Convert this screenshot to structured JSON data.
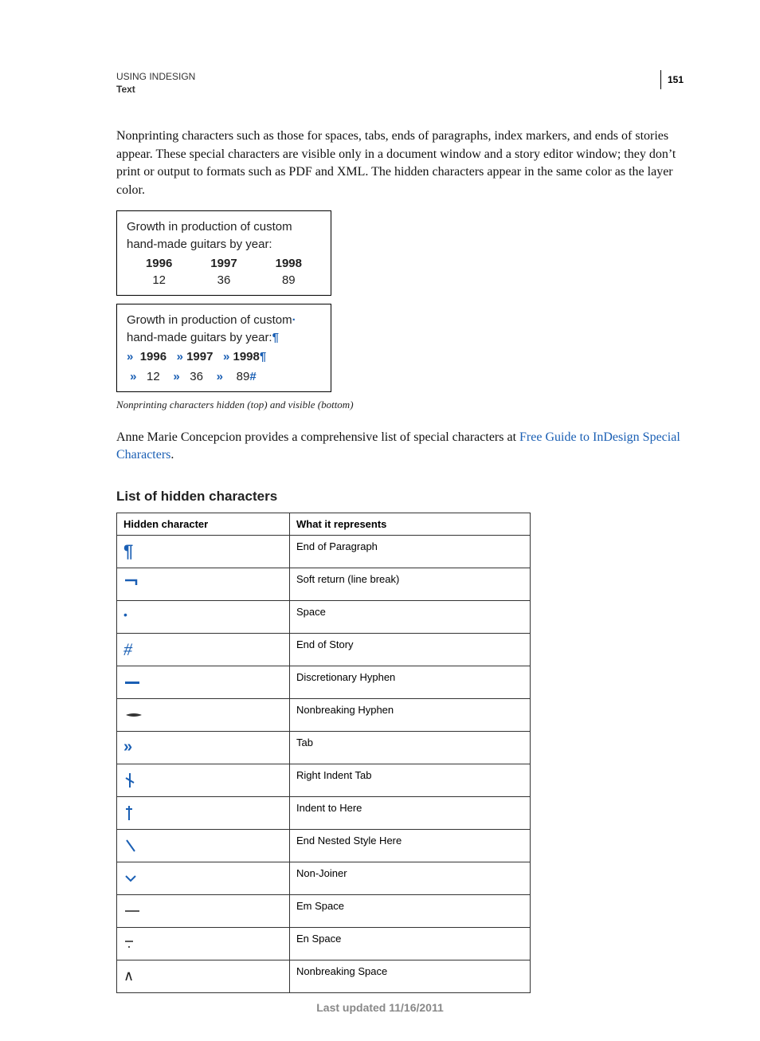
{
  "header": {
    "line1": "USING INDESIGN",
    "line2": "Text",
    "page_number": "151"
  },
  "paragraphs": {
    "intro": "Nonprinting characters such as those for spaces, tabs, ends of paragraphs, index markers, and ends of stories appear. These special characters are visible only in a document window and a story editor window; they don’t print or output to formats such as PDF and XML. The hidden characters appear in the same color as the layer color.",
    "link_lead": "Anne Marie Concepcion provides a comprehensive list of special characters at ",
    "link_text": "Free Guide to InDesign Special Characters",
    "link_trail": "."
  },
  "figure": {
    "title_line1": "Growth in production of custom",
    "title_line2": "hand-made guitars by year:",
    "years": [
      "1996",
      "1997",
      "1998"
    ],
    "values": [
      "12",
      "36",
      "89"
    ],
    "caption": "Nonprinting characters hidden (top) and visible (bottom)"
  },
  "section_heading": "List of hidden characters",
  "table": {
    "col1": "Hidden character",
    "col2": "What it represents",
    "rows": [
      {
        "symbol": "pilcrow",
        "meaning": "End of Paragraph"
      },
      {
        "symbol": "softreturn",
        "meaning": "Soft return (line break)"
      },
      {
        "symbol": "space-dot",
        "meaning": "Space"
      },
      {
        "symbol": "end-of-story",
        "meaning": "End of Story"
      },
      {
        "symbol": "disc-hyphen",
        "meaning": "Discretionary Hyphen"
      },
      {
        "symbol": "nb-hyphen",
        "meaning": "Nonbreaking Hyphen"
      },
      {
        "symbol": "tab",
        "meaning": "Tab"
      },
      {
        "symbol": "right-indent-tab",
        "meaning": "Right Indent Tab"
      },
      {
        "symbol": "indent-to-here",
        "meaning": "Indent to Here"
      },
      {
        "symbol": "end-nested",
        "meaning": "End Nested Style Here"
      },
      {
        "symbol": "non-joiner",
        "meaning": "Non-Joiner"
      },
      {
        "symbol": "em-space",
        "meaning": "Em Space"
      },
      {
        "symbol": "en-space",
        "meaning": "En Space"
      },
      {
        "symbol": "nb-space",
        "meaning": "Nonbreaking Space"
      }
    ]
  },
  "footer": "Last updated 11/16/2011",
  "chart_data": {
    "type": "table",
    "title": "Growth in production of custom hand-made guitars by year",
    "categories": [
      "1996",
      "1997",
      "1998"
    ],
    "values": [
      12,
      36,
      89
    ]
  }
}
